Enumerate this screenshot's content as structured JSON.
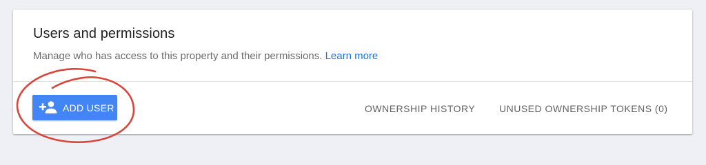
{
  "panel": {
    "title": "Users and permissions",
    "description": "Manage who has access to this property and their permissions.",
    "learn_more_label": "Learn more"
  },
  "actions": {
    "add_user_label": "ADD USER",
    "add_user_icon": "person-add-icon",
    "ownership_history_label": "OWNERSHIP HISTORY",
    "unused_tokens_label": "UNUSED OWNERSHIP TOKENS (0)"
  },
  "colors": {
    "page_background": "#eef0f6",
    "card_background": "#ffffff",
    "primary_button": "#4285f4",
    "link": "#1a73e8",
    "annotation_circle": "#d9453a"
  }
}
